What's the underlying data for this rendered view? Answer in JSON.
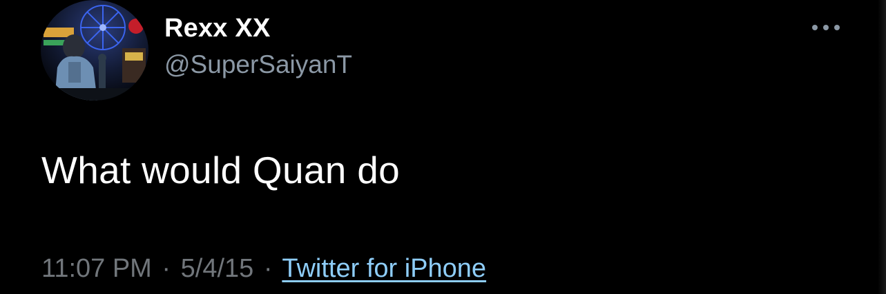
{
  "tweet": {
    "author": {
      "display_name": "Rexx XX",
      "handle": "@SuperSaiyanT"
    },
    "text": "What would Quan do",
    "time": "11:07 PM",
    "separator": "·",
    "date": "5/4/15",
    "source": "Twitter for iPhone"
  },
  "icons": {
    "more": "more-horizontal-icon"
  },
  "colors": {
    "background": "#000000",
    "name": "#ffffff",
    "handle": "#8b98a5",
    "meta": "#71767b",
    "link": "#8ecdf8"
  }
}
